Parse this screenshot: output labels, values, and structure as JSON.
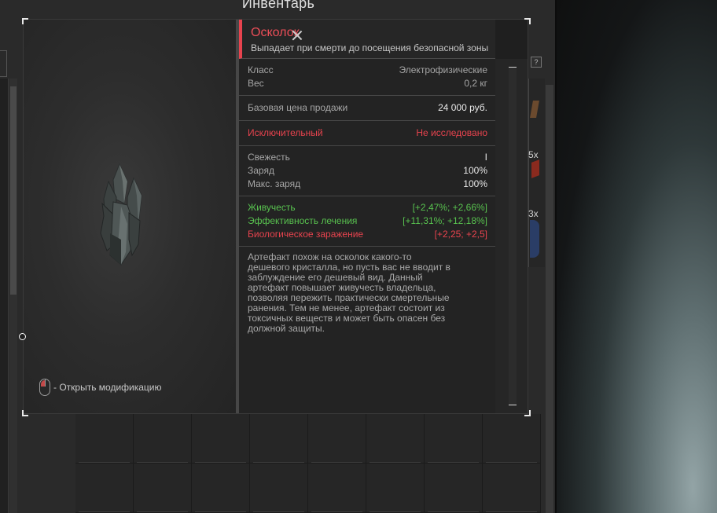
{
  "inventory": {
    "title": "Инвентарь",
    "help_badge": "?",
    "side_labels": [
      "5x",
      "3x"
    ]
  },
  "item": {
    "name": "Осколок",
    "subtitle": "Выпадает при смерти до посещения безопасной зоны",
    "stats": [
      {
        "key": "Класс",
        "value": "Электрофизические"
      },
      {
        "key": "Вес",
        "value": "0,2 кг"
      }
    ],
    "price": {
      "key": "Базовая цена продажи",
      "value": "24 000 руб."
    },
    "rarity": {
      "key": "Исключительный",
      "value": "Не исследовано"
    },
    "condition": [
      {
        "key": "Свежесть",
        "value": "I"
      },
      {
        "key": "Заряд",
        "value": "100%"
      },
      {
        "key": "Макс. заряд",
        "value": "100%"
      }
    ],
    "effects": [
      {
        "key": "Живучесть",
        "value": "[+2,47%; +2,66%]",
        "color": "#58c24f"
      },
      {
        "key": "Эффективность лечения",
        "value": "[+11,31%; +12,18%]",
        "color": "#58c24f"
      },
      {
        "key": "Биологическое заражение",
        "value": "[+2,25; +2,5]",
        "color": "#e8434e"
      }
    ],
    "description": "Артефакт похож на осколок какого-то дешевого кристалла, но пусть вас не вводит в заблуждение его дешевый вид. Данный артефакт повышает живучесть владельца, позволяя пережить практически смертельные ранения. Тем не менее, артефакт состоит из токсичных веществ и может быть опасен без должной защиты.",
    "mouse_hint": "- Открыть модификацию",
    "accent_color": "#e8434e"
  },
  "icons": {
    "close": "close-icon",
    "mouse": "mouse-icon",
    "artifact": "crystal-artifact-icon"
  }
}
